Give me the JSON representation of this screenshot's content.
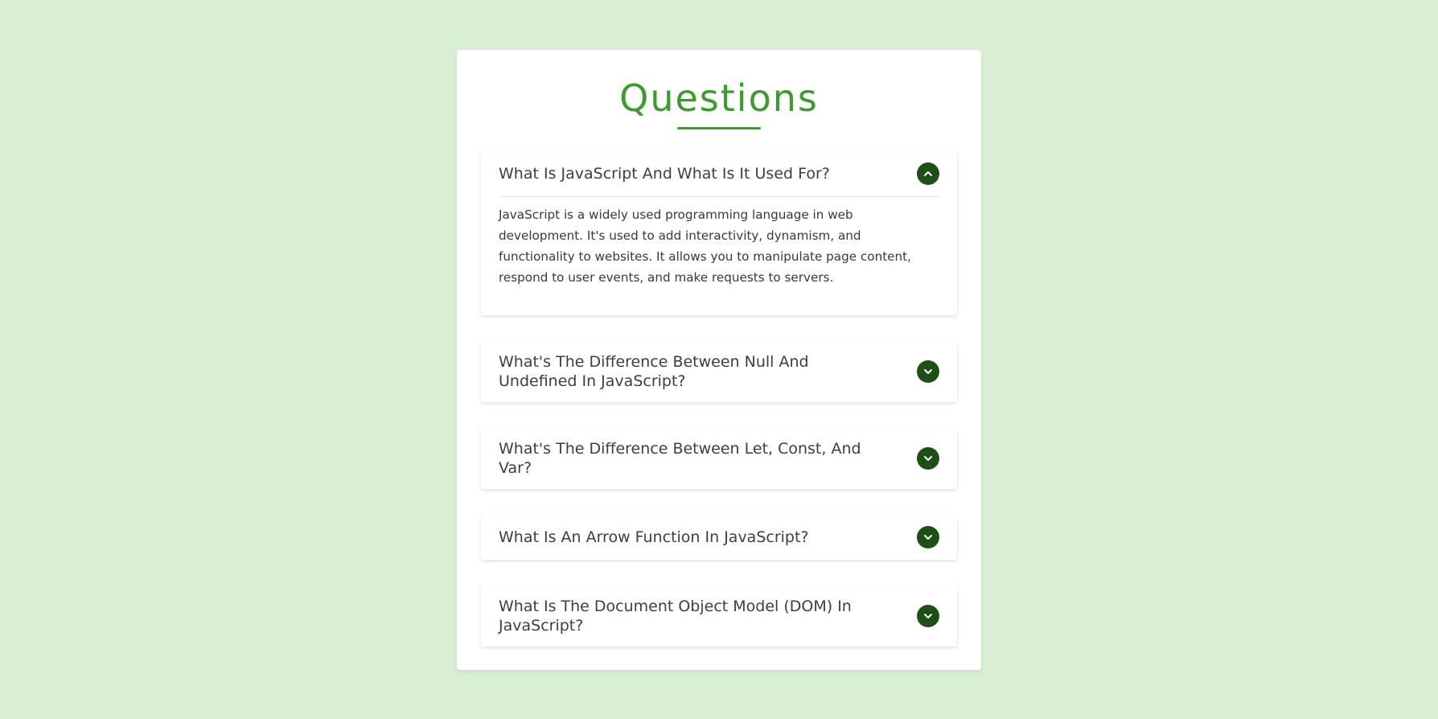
{
  "page": {
    "title": "Questions"
  },
  "colors": {
    "background": "#d8efd3",
    "accent": "#3c9a2f",
    "button": "#1e4f17",
    "question_text": "#3a3e4a"
  },
  "faq": [
    {
      "question": "What Is JavaScript And What Is It Used For?",
      "answer": "JavaScript is a widely used programming language in web development. It's used to add interactivity, dynamism, and functionality to websites. It allows you to manipulate page content, respond to user events, and make requests to servers.",
      "expanded": true,
      "icon": "chevron-up-icon"
    },
    {
      "question": "What's The Difference Between Null And Undefined In JavaScript?",
      "expanded": false,
      "icon": "chevron-down-icon"
    },
    {
      "question": "What's The Difference Between Let, Const, And Var?",
      "expanded": false,
      "icon": "chevron-down-icon"
    },
    {
      "question": "What Is An Arrow Function In JavaScript?",
      "expanded": false,
      "icon": "chevron-down-icon"
    },
    {
      "question": "What Is The Document Object Model (DOM) In JavaScript?",
      "expanded": false,
      "icon": "chevron-down-icon"
    }
  ]
}
